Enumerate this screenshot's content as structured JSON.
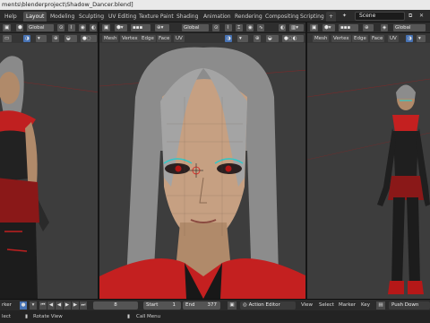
{
  "window": {
    "title": "ments\\blenderproject\\Shadow_Dancer.blend]"
  },
  "topbar": {
    "help": "Help",
    "workspaces": [
      "Layout",
      "Modeling",
      "Sculpting",
      "UV Editing",
      "Texture Paint",
      "Shading",
      "Animation",
      "Rendering",
      "Compositing",
      "Scripting"
    ],
    "active_workspace": "Layout",
    "add_tab": "+",
    "scene": "Scene"
  },
  "viewports": {
    "left": {
      "orientation": "Global"
    },
    "center": {
      "orientation": "Global",
      "mode_items": [
        "Mesh",
        "Vertex",
        "Edge",
        "Face",
        "UV"
      ]
    },
    "right": {
      "orientation": "Global",
      "mode_items": [
        "Mesh",
        "Vertex",
        "Edge",
        "Face",
        "UV"
      ]
    }
  },
  "timeline": {
    "marker_label": "rker",
    "current_frame": "8",
    "start_label": "Start",
    "start": "1",
    "end_label": "End",
    "end": "377",
    "editor": "Action Editor",
    "menu": [
      "View",
      "Select",
      "Marker",
      "Key"
    ],
    "push_down": "Push Down"
  },
  "statusbar": {
    "select": "lect",
    "rotate": "Rotate View",
    "call_menu": "Call Menu"
  },
  "colors": {
    "accent": "#4772b3",
    "viewport_bg": "#3d3d3d",
    "header_bg": "#2e2e2e"
  }
}
